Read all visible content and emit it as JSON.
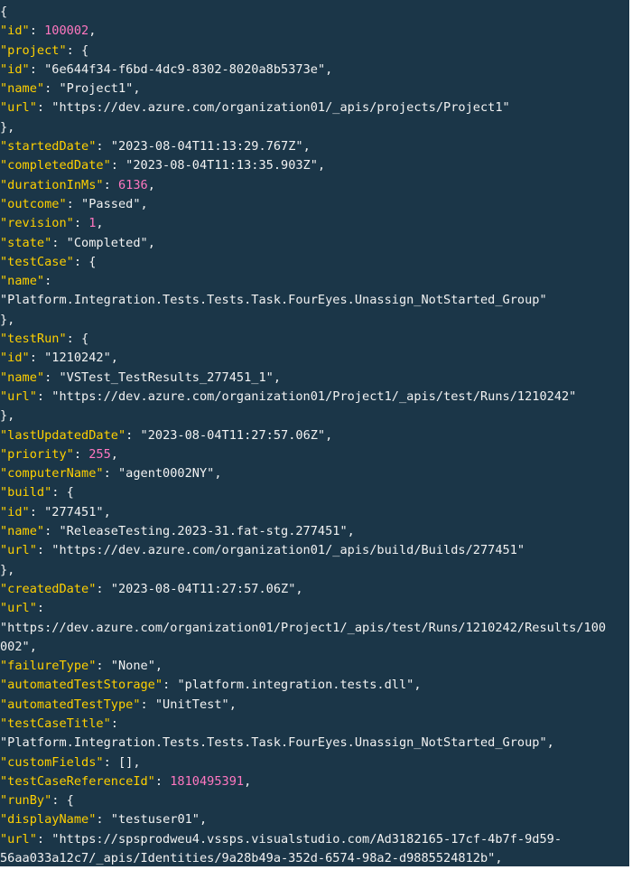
{
  "colors": {
    "background": "#1b3648",
    "key": "#ffd000",
    "string": "#f2f2f2",
    "number": "#ff77c0",
    "punctuation": "#f2f2f2"
  },
  "lines": [
    [
      {
        "t": "p",
        "v": "{"
      }
    ],
    [
      {
        "t": "k",
        "v": "\"id\""
      },
      {
        "t": "p",
        "v": ": "
      },
      {
        "t": "n",
        "v": "100002"
      },
      {
        "t": "p",
        "v": ","
      }
    ],
    [
      {
        "t": "k",
        "v": "\"project\""
      },
      {
        "t": "p",
        "v": ": {"
      }
    ],
    [
      {
        "t": "k",
        "v": "\"id\""
      },
      {
        "t": "p",
        "v": ": "
      },
      {
        "t": "s",
        "v": "\"6e644f34-f6bd-4dc9-8302-8020a8b5373e\""
      },
      {
        "t": "p",
        "v": ","
      }
    ],
    [
      {
        "t": "k",
        "v": "\"name\""
      },
      {
        "t": "p",
        "v": ": "
      },
      {
        "t": "s",
        "v": "\"Project1\""
      },
      {
        "t": "p",
        "v": ","
      }
    ],
    [
      {
        "t": "k",
        "v": "\"url\""
      },
      {
        "t": "p",
        "v": ": "
      },
      {
        "t": "s",
        "v": "\"https://dev.azure.com/organization01/_apis/projects/Project1\""
      }
    ],
    [
      {
        "t": "p",
        "v": "},"
      }
    ],
    [
      {
        "t": "k",
        "v": "\"startedDate\""
      },
      {
        "t": "p",
        "v": ": "
      },
      {
        "t": "s",
        "v": "\"2023-08-04T11:13:29.767Z\""
      },
      {
        "t": "p",
        "v": ","
      }
    ],
    [
      {
        "t": "k",
        "v": "\"completedDate\""
      },
      {
        "t": "p",
        "v": ": "
      },
      {
        "t": "s",
        "v": "\"2023-08-04T11:13:35.903Z\""
      },
      {
        "t": "p",
        "v": ","
      }
    ],
    [
      {
        "t": "k",
        "v": "\"durationInMs\""
      },
      {
        "t": "p",
        "v": ": "
      },
      {
        "t": "n",
        "v": "6136"
      },
      {
        "t": "p",
        "v": ","
      }
    ],
    [
      {
        "t": "k",
        "v": "\"outcome\""
      },
      {
        "t": "p",
        "v": ": "
      },
      {
        "t": "s",
        "v": "\"Passed\""
      },
      {
        "t": "p",
        "v": ","
      }
    ],
    [
      {
        "t": "k",
        "v": "\"revision\""
      },
      {
        "t": "p",
        "v": ": "
      },
      {
        "t": "n",
        "v": "1"
      },
      {
        "t": "p",
        "v": ","
      }
    ],
    [
      {
        "t": "k",
        "v": "\"state\""
      },
      {
        "t": "p",
        "v": ": "
      },
      {
        "t": "s",
        "v": "\"Completed\""
      },
      {
        "t": "p",
        "v": ","
      }
    ],
    [
      {
        "t": "k",
        "v": "\"testCase\""
      },
      {
        "t": "p",
        "v": ": {"
      }
    ],
    [
      {
        "t": "k",
        "v": "\"name\""
      },
      {
        "t": "p",
        "v": ":"
      }
    ],
    [
      {
        "t": "s",
        "v": "\"Platform.Integration.Tests.Tests.Task.FourEyes.Unassign_NotStarted_Group\""
      }
    ],
    [
      {
        "t": "p",
        "v": "},"
      }
    ],
    [
      {
        "t": "k",
        "v": "\"testRun\""
      },
      {
        "t": "p",
        "v": ": {"
      }
    ],
    [
      {
        "t": "k",
        "v": "\"id\""
      },
      {
        "t": "p",
        "v": ": "
      },
      {
        "t": "s",
        "v": "\"1210242\""
      },
      {
        "t": "p",
        "v": ","
      }
    ],
    [
      {
        "t": "k",
        "v": "\"name\""
      },
      {
        "t": "p",
        "v": ": "
      },
      {
        "t": "s",
        "v": "\"VSTest_TestResults_277451_1\""
      },
      {
        "t": "p",
        "v": ","
      }
    ],
    [
      {
        "t": "k",
        "v": "\"url\""
      },
      {
        "t": "p",
        "v": ": "
      },
      {
        "t": "s",
        "v": "\"https://dev.azure.com/organization01/Project1/_apis/test/Runs/1210242\""
      }
    ],
    [
      {
        "t": "p",
        "v": "},"
      }
    ],
    [
      {
        "t": "k",
        "v": "\"lastUpdatedDate\""
      },
      {
        "t": "p",
        "v": ": "
      },
      {
        "t": "s",
        "v": "\"2023-08-04T11:27:57.06Z\""
      },
      {
        "t": "p",
        "v": ","
      }
    ],
    [
      {
        "t": "k",
        "v": "\"priority\""
      },
      {
        "t": "p",
        "v": ": "
      },
      {
        "t": "n",
        "v": "255"
      },
      {
        "t": "p",
        "v": ","
      }
    ],
    [
      {
        "t": "k",
        "v": "\"computerName\""
      },
      {
        "t": "p",
        "v": ": "
      },
      {
        "t": "s",
        "v": "\"agent0002NY\""
      },
      {
        "t": "p",
        "v": ","
      }
    ],
    [
      {
        "t": "k",
        "v": "\"build\""
      },
      {
        "t": "p",
        "v": ": {"
      }
    ],
    [
      {
        "t": "k",
        "v": "\"id\""
      },
      {
        "t": "p",
        "v": ": "
      },
      {
        "t": "s",
        "v": "\"277451\""
      },
      {
        "t": "p",
        "v": ","
      }
    ],
    [
      {
        "t": "k",
        "v": "\"name\""
      },
      {
        "t": "p",
        "v": ": "
      },
      {
        "t": "s",
        "v": "\"ReleaseTesting.2023-31.fat-stg.277451\""
      },
      {
        "t": "p",
        "v": ","
      }
    ],
    [
      {
        "t": "k",
        "v": "\"url\""
      },
      {
        "t": "p",
        "v": ": "
      },
      {
        "t": "s",
        "v": "\"https://dev.azure.com/organization01/_apis/build/Builds/277451\""
      }
    ],
    [
      {
        "t": "p",
        "v": "},"
      }
    ],
    [
      {
        "t": "k",
        "v": "\"createdDate\""
      },
      {
        "t": "p",
        "v": ": "
      },
      {
        "t": "s",
        "v": "\"2023-08-04T11:27:57.06Z\""
      },
      {
        "t": "p",
        "v": ","
      }
    ],
    [
      {
        "t": "k",
        "v": "\"url\""
      },
      {
        "t": "p",
        "v": ":"
      }
    ],
    [
      {
        "t": "s",
        "v": "\"https://dev.azure.com/organization01/Project1/_apis/test/Runs/1210242/Results/100"
      }
    ],
    [
      {
        "t": "s",
        "v": "002\""
      },
      {
        "t": "p",
        "v": ","
      }
    ],
    [
      {
        "t": "k",
        "v": "\"failureType\""
      },
      {
        "t": "p",
        "v": ": "
      },
      {
        "t": "s",
        "v": "\"None\""
      },
      {
        "t": "p",
        "v": ","
      }
    ],
    [
      {
        "t": "k",
        "v": "\"automatedTestStorage\""
      },
      {
        "t": "p",
        "v": ": "
      },
      {
        "t": "s",
        "v": "\"platform.integration.tests.dll\""
      },
      {
        "t": "p",
        "v": ","
      }
    ],
    [
      {
        "t": "k",
        "v": "\"automatedTestType\""
      },
      {
        "t": "p",
        "v": ": "
      },
      {
        "t": "s",
        "v": "\"UnitTest\""
      },
      {
        "t": "p",
        "v": ","
      }
    ],
    [
      {
        "t": "k",
        "v": "\"testCaseTitle\""
      },
      {
        "t": "p",
        "v": ":"
      }
    ],
    [
      {
        "t": "s",
        "v": "\"Platform.Integration.Tests.Tests.Task.FourEyes.Unassign_NotStarted_Group\""
      },
      {
        "t": "p",
        "v": ","
      }
    ],
    [
      {
        "t": "k",
        "v": "\"customFields\""
      },
      {
        "t": "p",
        "v": ": [],"
      }
    ],
    [
      {
        "t": "k",
        "v": "\"testCaseReferenceId\""
      },
      {
        "t": "p",
        "v": ": "
      },
      {
        "t": "n",
        "v": "1810495391"
      },
      {
        "t": "p",
        "v": ","
      }
    ],
    [
      {
        "t": "k",
        "v": "\"runBy\""
      },
      {
        "t": "p",
        "v": ": {"
      }
    ],
    [
      {
        "t": "k",
        "v": "\"displayName\""
      },
      {
        "t": "p",
        "v": ": "
      },
      {
        "t": "s",
        "v": "\"testuser01\""
      },
      {
        "t": "p",
        "v": ","
      }
    ],
    [
      {
        "t": "k",
        "v": "\"url\""
      },
      {
        "t": "p",
        "v": ": "
      },
      {
        "t": "s",
        "v": "\"https://spsprodweu4.vssps.visualstudio.com/Ad3182165-17cf-4b7f-9d59-"
      }
    ],
    [
      {
        "t": "s",
        "v": "56aa033a12c7/_apis/Identities/9a28b49a-352d-6574-98a2-d9885524812b\""
      },
      {
        "t": "p",
        "v": ","
      }
    ]
  ]
}
